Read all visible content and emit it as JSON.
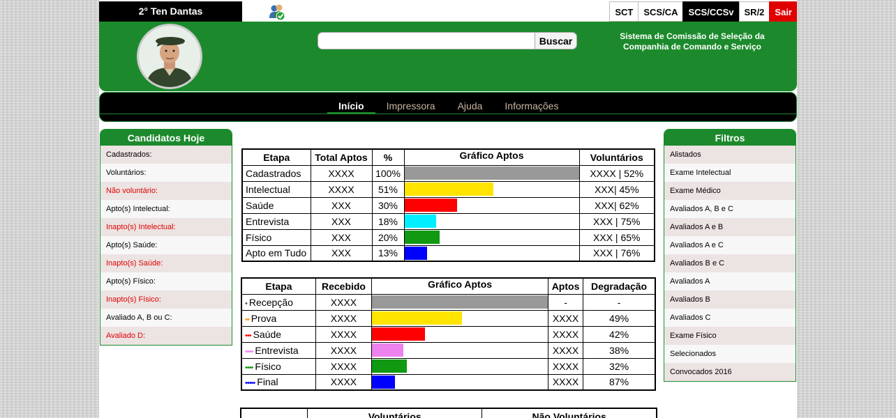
{
  "topbar": {
    "user": "2° Ten Dantas",
    "links": [
      {
        "label": "SCT",
        "style": "normal"
      },
      {
        "label": "SCS/CA",
        "style": "normal"
      },
      {
        "label": "SCS/CCSv",
        "style": "active"
      },
      {
        "label": "SR/2",
        "style": "normal"
      },
      {
        "label": "Sair",
        "style": "exit"
      }
    ]
  },
  "header": {
    "search_placeholder": "",
    "search_button": "Buscar",
    "title_line1": "Sistema de Comissão de Seleção da",
    "title_line2": "Companhia de Comando e Serviço"
  },
  "nav": {
    "items": [
      "Início",
      "Impressora",
      "Ajuda",
      "Informações"
    ],
    "active": 0
  },
  "left_panel": {
    "title": "Candidatos Hoje",
    "items": [
      {
        "label": "Cadastrados:",
        "red": false
      },
      {
        "label": "Voluntários:",
        "red": false
      },
      {
        "label": "Não voluntário:",
        "red": true
      },
      {
        "label": "Apto(s) Intelectual:",
        "red": false
      },
      {
        "label": "Inapto(s) Intelectual:",
        "red": true
      },
      {
        "label": "Apto(s) Saúde:",
        "red": false
      },
      {
        "label": "Inapto(s) Saúde:",
        "red": true
      },
      {
        "label": "Apto(s) Físico:",
        "red": false
      },
      {
        "label": "Inapto(s) Físico:",
        "red": true
      },
      {
        "label": "Avaliado A, B ou C:",
        "red": false
      },
      {
        "label": "Avaliado D:",
        "red": true
      }
    ]
  },
  "right_panel": {
    "title": "Filtros",
    "items": [
      "Alistados",
      "Exame Intelectual",
      "Exame Médico",
      "Avaliados A, B e C",
      "Avaliados A e B",
      "Avaliados A e C",
      "Avaliados B e C",
      "Avaliados A",
      "Avaliados B",
      "Avaliados C",
      "Exame Físico",
      "Selecionados",
      "Convocados 2016"
    ]
  },
  "table1": {
    "headers": [
      "Etapa",
      "Total Aptos",
      "%",
      "Gráfico Aptos",
      "Voluntários"
    ],
    "rows": [
      {
        "etapa": "Cadastrados",
        "total": "XXXX",
        "pct": "100%",
        "bar": 100,
        "color": "#999999",
        "vol": "XXXX | 52%"
      },
      {
        "etapa": "Intelectual",
        "total": "XXXX",
        "pct": "51%",
        "bar": 51,
        "color": "#ffe400",
        "vol": "XXX| 45%"
      },
      {
        "etapa": "Saúde",
        "total": "XXX",
        "pct": "30%",
        "bar": 30,
        "color": "#ff0000",
        "vol": "XXX| 62%"
      },
      {
        "etapa": "Entrevista",
        "total": "XXX",
        "pct": "18%",
        "bar": 18,
        "color": "#00eeff",
        "vol": "XXX | 75%"
      },
      {
        "etapa": "Físico",
        "total": "XXX",
        "pct": "20%",
        "bar": 20,
        "color": "#119911",
        "vol": "XXX | 65%"
      },
      {
        "etapa": "Apto em Tudo",
        "total": "XXX",
        "pct": "13%",
        "bar": 13,
        "color": "#0000ff",
        "vol": "XXX | 76%"
      }
    ]
  },
  "table2": {
    "headers": [
      "Etapa",
      "Recebido",
      "Gráfico Aptos",
      "Aptos",
      "Degradação"
    ],
    "rows": [
      {
        "dots": "•",
        "dot_color": "#555555",
        "etapa": "Recepção",
        "recebido": "XXXX",
        "bar": 100,
        "color": "#999999",
        "aptos": "-",
        "degr": "-"
      },
      {
        "dots": "••",
        "dot_color": "#ff9900",
        "etapa": "Prova",
        "recebido": "XXXX",
        "bar": 51,
        "color": "#ffe400",
        "aptos": "XXXX",
        "degr": "49%"
      },
      {
        "dots": "•••",
        "dot_color": "#ff0000",
        "etapa": "Saúde",
        "recebido": "XXXX",
        "bar": 30,
        "color": "#ff0000",
        "aptos": "XXXX",
        "degr": "42%"
      },
      {
        "dots": "••••",
        "dot_color": "#ee82ee",
        "etapa": "Entrevista",
        "recebido": "XXXX",
        "bar": 18,
        "color": "#ee82ee",
        "aptos": "XXXX",
        "degr": "38%"
      },
      {
        "dots": "••••",
        "dot_color": "#119911",
        "etapa": "Físico",
        "recebido": "XXXX",
        "bar": 20,
        "color": "#119911",
        "aptos": "XXXX",
        "degr": "32%"
      },
      {
        "dots": "•••••",
        "dot_color": "#0000ff",
        "etapa": "Final",
        "recebido": "XXXX",
        "bar": 13,
        "color": "#0000ff",
        "aptos": "XXXX",
        "degr": "87%"
      }
    ]
  },
  "table3": {
    "headers": [
      "",
      "Voluntários",
      "Não Voluntários"
    ]
  }
}
